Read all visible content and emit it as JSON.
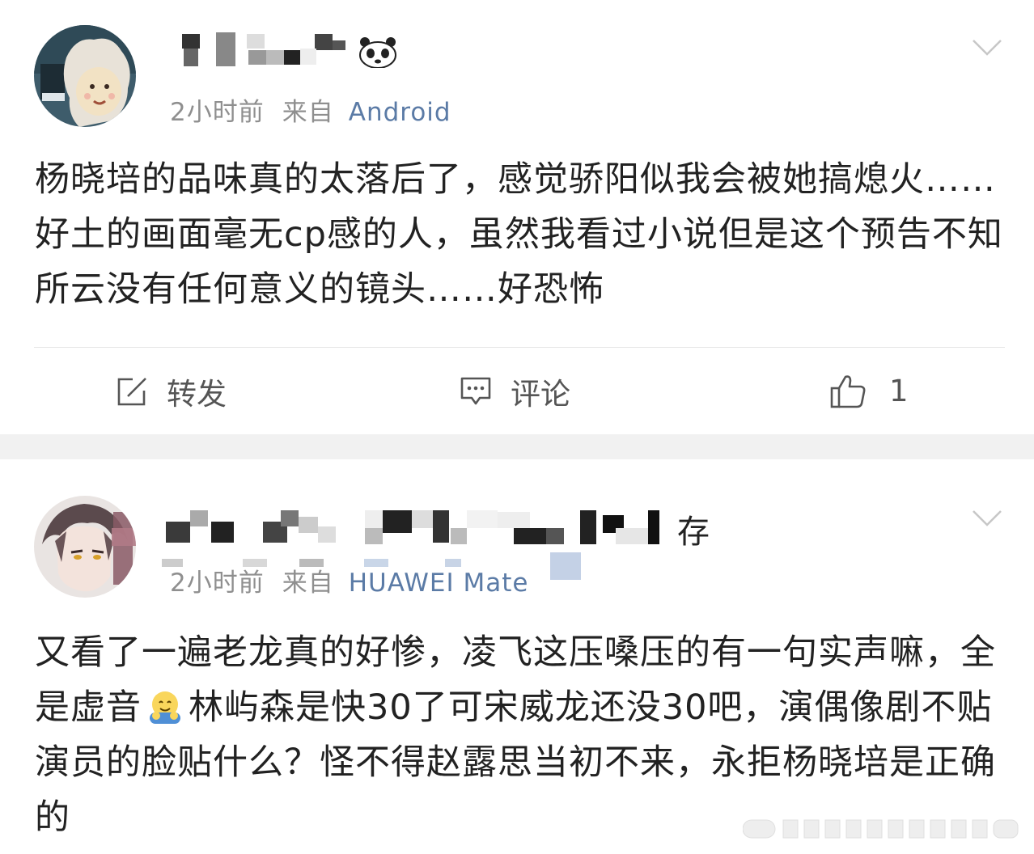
{
  "posts": [
    {
      "time": "2小时前",
      "source_label": "来自",
      "source": "Android",
      "content": "杨晓培的品味真的太落后了，感觉骄阳似我会被她搞熄火……好土的画面毫无cp感的人，虽然我看过小说但是这个预告不知所云没有任何意义的镜头……好恐怖",
      "actions": {
        "repost": "转发",
        "comment": "评论",
        "like": "1"
      }
    },
    {
      "username_visible": "存",
      "time": "2小时前",
      "source_label": "来自",
      "source": "HUAWEI Mate",
      "content_part1": "又看了一遍老龙真的好惨，凌飞这压嗓压的有一句实声嘛，全是虚音",
      "content_part2": "林屿森是快30了可宋威龙还没30吧，演偶像剧不贴演员的脸贴什么？怪不得赵露思当初不来，永拒杨晓培是正确的"
    }
  ],
  "icons": {
    "repost": "edit-square-icon",
    "comment": "comment-bubble-icon",
    "like": "thumbs-up-icon",
    "more": "chevron-down-icon",
    "emoji": "hugging-face-emoji"
  },
  "colors": {
    "text": "#222222",
    "meta": "#8f8f8f",
    "source_link": "#5b7ba6",
    "separator": "#f1f1f1"
  }
}
